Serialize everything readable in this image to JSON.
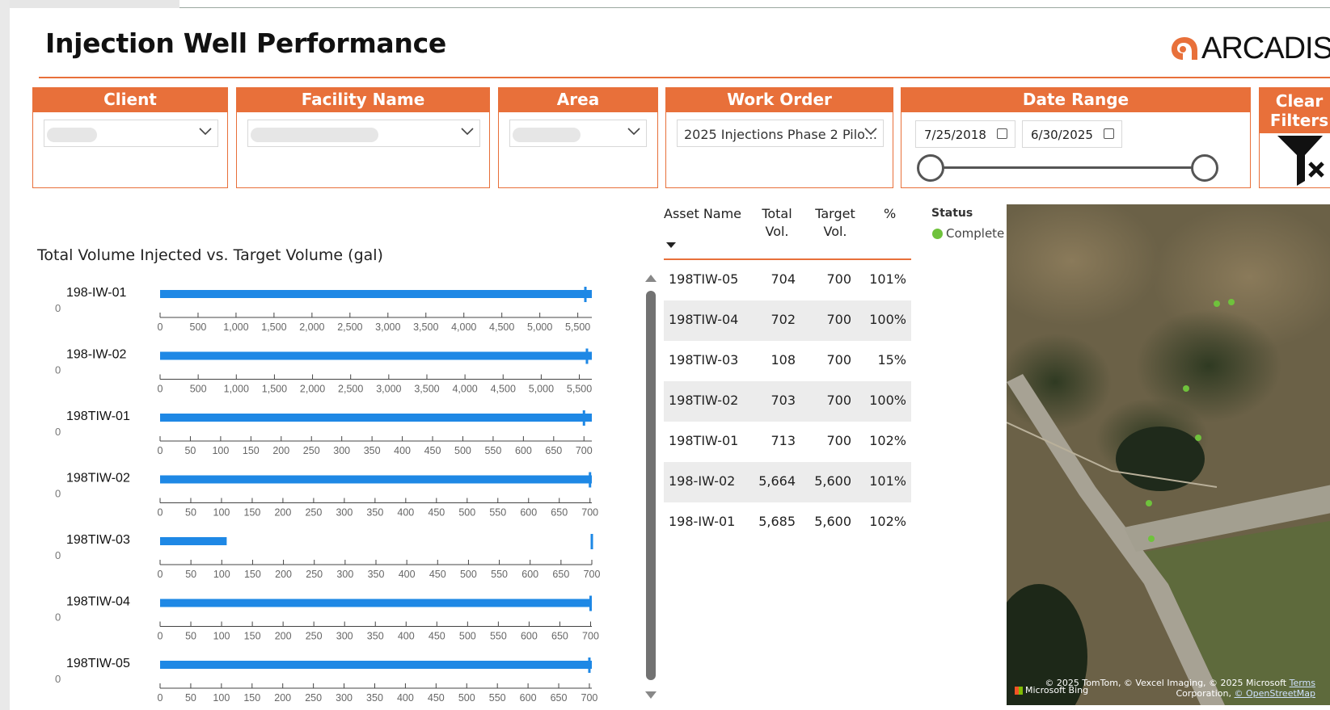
{
  "page": {
    "title": "Injection Well Performance",
    "logo_text": "ARCADIS"
  },
  "filters": {
    "client": {
      "label": "Client",
      "value": ""
    },
    "facility": {
      "label": "Facility Name",
      "value": ""
    },
    "area": {
      "label": "Area",
      "value": ""
    },
    "work_order": {
      "label": "Work Order",
      "value": "2025 Injections Phase 2 Pilo..."
    },
    "date_range": {
      "label": "Date Range",
      "start": "7/25/2018",
      "end": "6/30/2025"
    },
    "clear": {
      "label": "Clear Filters"
    }
  },
  "chart": {
    "title": "Total Volume Injected vs. Target Volume (gal)"
  },
  "chart_data": {
    "type": "bar",
    "subtype": "bullet",
    "title": "Total Volume Injected vs. Target Volume (gal)",
    "rows": [
      {
        "name": "198-IW-01",
        "value": 5685,
        "target": 5600,
        "min": 0,
        "max": 5685,
        "ticks": [
          0,
          500,
          1000,
          1500,
          2000,
          2500,
          3000,
          3500,
          4000,
          4500,
          5000,
          5500
        ],
        "tick_labels": [
          "0",
          "500",
          "1,000",
          "1,500",
          "2,000",
          "2,500",
          "3,000",
          "3,500",
          "4,000",
          "4,500",
          "5,000",
          "5,500"
        ]
      },
      {
        "name": "198-IW-02",
        "value": 5664,
        "target": 5600,
        "min": 0,
        "max": 5664,
        "ticks": [
          0,
          500,
          1000,
          1500,
          2000,
          2500,
          3000,
          3500,
          4000,
          4500,
          5000,
          5500
        ],
        "tick_labels": [
          "0",
          "500",
          "1,000",
          "1,500",
          "2,000",
          "2,500",
          "3,000",
          "3,500",
          "4,000",
          "4,500",
          "5,000",
          "5,500"
        ]
      },
      {
        "name": "198TIW-01",
        "value": 713,
        "target": 700,
        "min": 0,
        "max": 713,
        "ticks": [
          0,
          50,
          100,
          150,
          200,
          250,
          300,
          350,
          400,
          450,
          500,
          550,
          600,
          650,
          700
        ],
        "tick_labels": [
          "0",
          "50",
          "100",
          "150",
          "200",
          "250",
          "300",
          "350",
          "400",
          "450",
          "500",
          "550",
          "600",
          "650",
          "700"
        ]
      },
      {
        "name": "198TIW-02",
        "value": 703,
        "target": 700,
        "min": 0,
        "max": 703,
        "ticks": [
          0,
          50,
          100,
          150,
          200,
          250,
          300,
          350,
          400,
          450,
          500,
          550,
          600,
          650,
          700
        ],
        "tick_labels": [
          "0",
          "50",
          "100",
          "150",
          "200",
          "250",
          "300",
          "350",
          "400",
          "450",
          "500",
          "550",
          "600",
          "650",
          "700"
        ]
      },
      {
        "name": "198TIW-03",
        "value": 108,
        "target": 700,
        "min": 0,
        "max": 700,
        "ticks": [
          0,
          50,
          100,
          150,
          200,
          250,
          300,
          350,
          400,
          450,
          500,
          550,
          600,
          650,
          700
        ],
        "tick_labels": [
          "0",
          "50",
          "100",
          "150",
          "200",
          "250",
          "300",
          "350",
          "400",
          "450",
          "500",
          "550",
          "600",
          "650",
          "700"
        ]
      },
      {
        "name": "198TIW-04",
        "value": 702,
        "target": 700,
        "min": 0,
        "max": 702,
        "ticks": [
          0,
          50,
          100,
          150,
          200,
          250,
          300,
          350,
          400,
          450,
          500,
          550,
          600,
          650,
          700
        ],
        "tick_labels": [
          "0",
          "50",
          "100",
          "150",
          "200",
          "250",
          "300",
          "350",
          "400",
          "450",
          "500",
          "550",
          "600",
          "650",
          "700"
        ]
      },
      {
        "name": "198TIW-05",
        "value": 704,
        "target": 700,
        "min": 0,
        "max": 704,
        "ticks": [
          0,
          50,
          100,
          150,
          200,
          250,
          300,
          350,
          400,
          450,
          500,
          550,
          600,
          650,
          700
        ],
        "tick_labels": [
          "0",
          "50",
          "100",
          "150",
          "200",
          "250",
          "300",
          "350",
          "400",
          "450",
          "500",
          "550",
          "600",
          "650",
          "700"
        ]
      }
    ],
    "row_min_label": "0",
    "bar_color": "#1e88e5"
  },
  "table": {
    "headers": {
      "asset": "Asset Name",
      "total_a": "Total",
      "total_b": "Vol.",
      "target_a": "Target",
      "target_b": "Vol.",
      "pct": "%"
    },
    "rows": [
      {
        "asset": "198TIW-05",
        "total": "704",
        "target": "700",
        "pct": "101%"
      },
      {
        "asset": "198TIW-04",
        "total": "702",
        "target": "700",
        "pct": "100%"
      },
      {
        "asset": "198TIW-03",
        "total": "108",
        "target": "700",
        "pct": "15%"
      },
      {
        "asset": "198TIW-02",
        "total": "703",
        "target": "700",
        "pct": "100%"
      },
      {
        "asset": "198TIW-01",
        "total": "713",
        "target": "700",
        "pct": "102%"
      },
      {
        "asset": "198-IW-02",
        "total": "5,664",
        "target": "5,600",
        "pct": "101%"
      },
      {
        "asset": "198-IW-01",
        "total": "5,685",
        "target": "5,600",
        "pct": "102%"
      }
    ]
  },
  "map": {
    "legend_title": "Status",
    "legend_item": "Complete",
    "legend_color": "#6fc23c",
    "brand": "Microsoft Bing",
    "attribution_1": "© 2025 TomTom, © Vexcel Imaging, © 2025 Microsoft",
    "attribution_terms": "Terms",
    "attribution_2": "Corporation,",
    "attribution_osm": "© OpenStreetMap"
  },
  "colors": {
    "accent": "#e8703a",
    "bar": "#1e88e5",
    "status_complete": "#6fc23c"
  }
}
